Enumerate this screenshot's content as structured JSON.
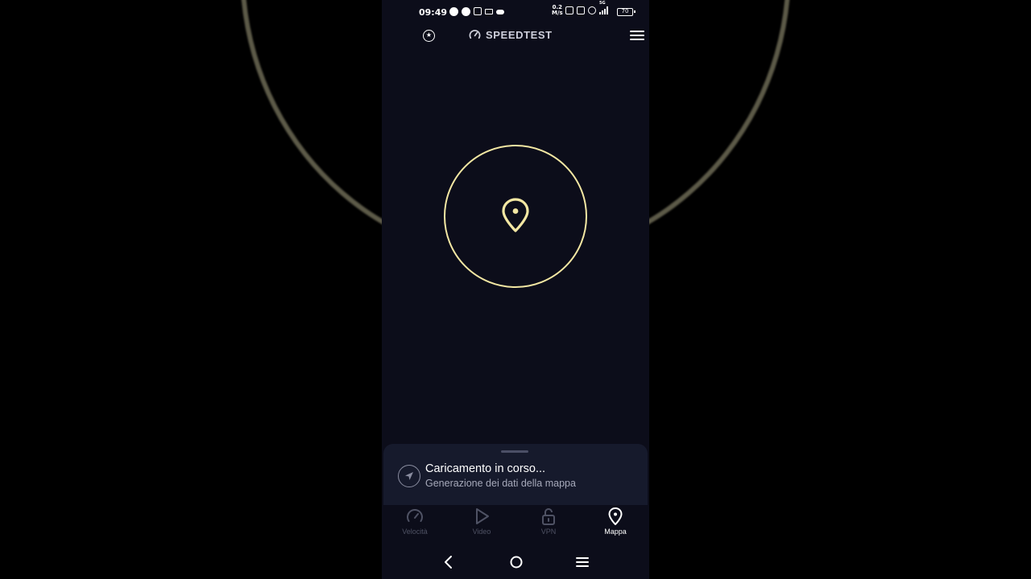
{
  "status_bar": {
    "time": "09:49",
    "net_speed_value": "0.2",
    "net_speed_unit": "M/s",
    "network_type": "5G",
    "battery": "70"
  },
  "header": {
    "app_name": "SPEEDTEST",
    "logo_icon": "speedometer-icon",
    "left_icon": "star-circle-icon",
    "right_icon": "hamburger-menu-icon"
  },
  "loader": {
    "icon": "map-pin-icon",
    "ring_color": "#f3e7a3"
  },
  "sheet": {
    "title": "Caricamento in corso...",
    "subtitle": "Generazione dei dati della mappa",
    "icon": "navigation-arrow-icon"
  },
  "tabs": [
    {
      "label": "Velocità",
      "icon": "speedometer-icon",
      "active": false
    },
    {
      "label": "Video",
      "icon": "play-icon",
      "active": false
    },
    {
      "label": "VPN",
      "icon": "lock-open-icon",
      "active": false
    },
    {
      "label": "Mappa",
      "icon": "map-pin-icon",
      "active": true
    }
  ],
  "colors": {
    "background": "#0c0d1a",
    "sheet": "#161a2c",
    "accent": "#f3e7a3",
    "inactive_tab": "#4f5264"
  }
}
